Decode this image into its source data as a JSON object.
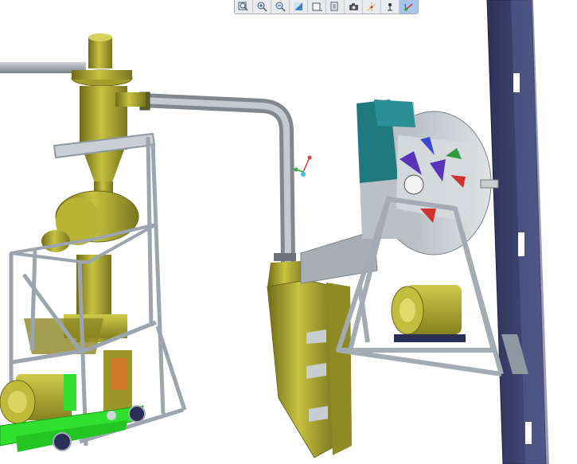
{
  "app": {
    "view": "3d-model-viewport"
  },
  "toolbar": {
    "buttons": [
      {
        "icon": "zoom-fit-icon",
        "active": false
      },
      {
        "icon": "zoom-in-icon",
        "active": false
      },
      {
        "icon": "zoom-out-icon",
        "active": false
      },
      {
        "icon": "shading-icon",
        "active": false
      },
      {
        "icon": "view-orientation-icon",
        "active": false
      },
      {
        "icon": "display-style-icon",
        "active": false
      },
      {
        "icon": "camera-icon",
        "active": false
      },
      {
        "icon": "axis-display-icon",
        "active": false
      },
      {
        "icon": "point-display-icon",
        "active": false
      },
      {
        "icon": "datum-csys-icon",
        "active": true
      }
    ]
  },
  "colors": {
    "background": "#ffffff",
    "olive_part": "#a7a22f",
    "steel_frame": "#aeb7c0",
    "pipe": "#9aa1a8",
    "teal_housing": "#1f7a80",
    "fan_gray": "#c3c8cc",
    "navy_column": "#3a3f66",
    "green_base": "#2fe02f",
    "axis_x": "#29b34a",
    "axis_y": "#e23b3b",
    "axis_z": "#36c2e6"
  }
}
